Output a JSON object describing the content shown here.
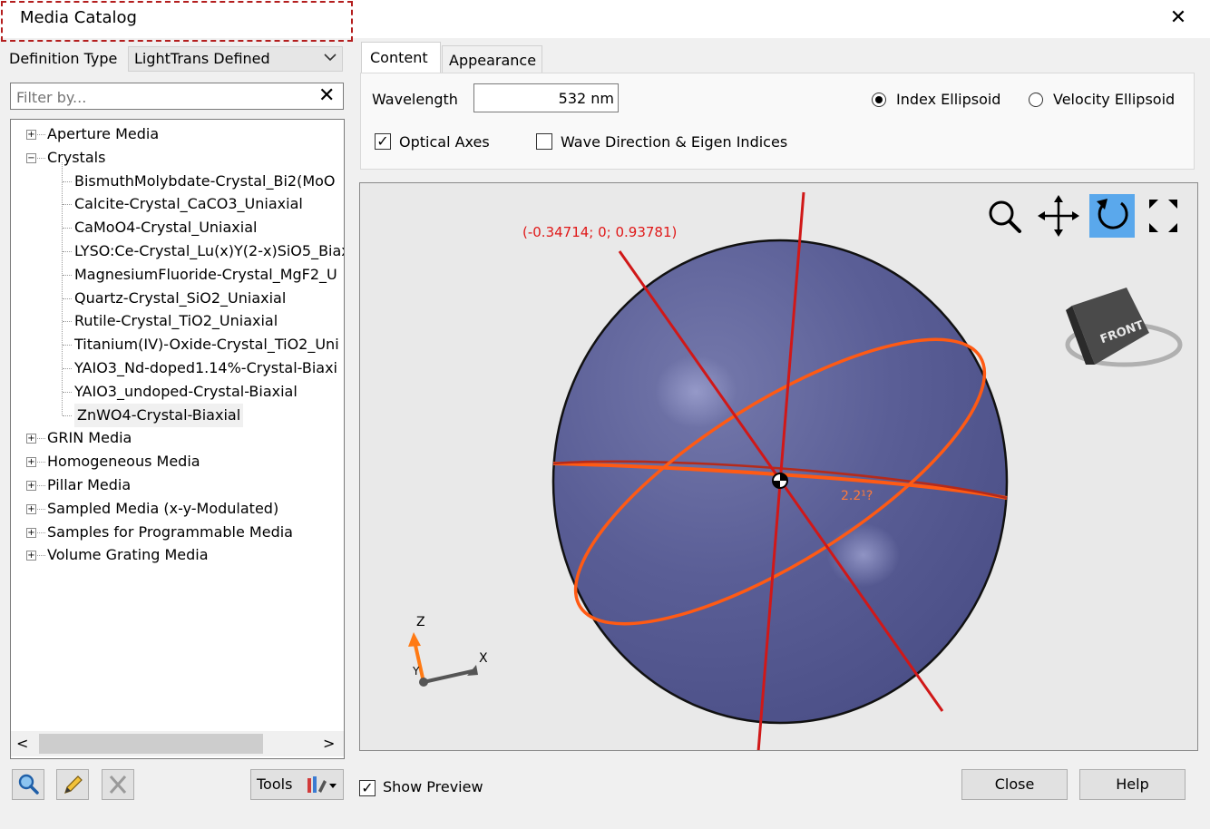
{
  "window": {
    "title": "Media Catalog",
    "close_glyph": "✕"
  },
  "definition": {
    "label": "Definition Type",
    "value": "LightTrans Defined"
  },
  "filter": {
    "placeholder": "Filter by...",
    "clear_glyph": "✕"
  },
  "tree": {
    "items": [
      {
        "label": "Aperture Media",
        "expanded": false
      },
      {
        "label": "Crystals",
        "expanded": true
      },
      {
        "label": "BismuthMolybdate-Crystal_Bi2(MoO"
      },
      {
        "label": "Calcite-Crystal_CaCO3_Uniaxial"
      },
      {
        "label": "CaMoO4-Crystal_Uniaxial"
      },
      {
        "label": "LYSO:Ce-Crystal_Lu(x)Y(2-x)SiO5_Biax"
      },
      {
        "label": "MagnesiumFluoride-Crystal_MgF2_U"
      },
      {
        "label": "Quartz-Crystal_SiO2_Uniaxial"
      },
      {
        "label": "Rutile-Crystal_TiO2_Uniaxial"
      },
      {
        "label": "Titanium(IV)-Oxide-Crystal_TiO2_Uni"
      },
      {
        "label": "YAIO3_Nd-doped1.14%-Crystal-Biaxi"
      },
      {
        "label": "YAIO3_undoped-Crystal-Biaxial"
      },
      {
        "label": "ZnWO4-Crystal-Biaxial",
        "selected": true
      },
      {
        "label": "GRIN Media",
        "expanded": false
      },
      {
        "label": "Homogeneous Media",
        "expanded": false
      },
      {
        "label": "Pillar Media",
        "expanded": false
      },
      {
        "label": "Sampled Media (x-y-Modulated)",
        "expanded": false
      },
      {
        "label": "Samples for Programmable Media",
        "expanded": false
      },
      {
        "label": "Volume Grating Media",
        "expanded": false
      }
    ],
    "scroll_left_glyph": "<",
    "scroll_right_glyph": ">"
  },
  "bottom_left": {
    "tools_label": "Tools",
    "icons": [
      "search-icon",
      "edit-pencil-icon",
      "delete-x-icon",
      "tools-wrench-icon"
    ]
  },
  "tabs": [
    {
      "label": "Content",
      "active": true
    },
    {
      "label": "Appearance",
      "active": false
    }
  ],
  "content": {
    "wavelength_label": "Wavelength",
    "wavelength_value": "532 nm",
    "radio_index": "Index Ellipsoid",
    "radio_velocity": "Velocity Ellipsoid",
    "selected_radio": "Index Ellipsoid",
    "check_optical_axes": "Optical Axes",
    "optical_axes_checked": true,
    "check_wave_direction": "Wave Direction & Eigen Indices",
    "wave_direction_checked": false
  },
  "viewport": {
    "coordinate_label": "(-0.34714; 0; 0.93781)",
    "partial_label": "2.2¹?",
    "cube_face_label": "FRONT",
    "axis_z": "Z",
    "axis_x": "X",
    "axis_y": "Y",
    "toolbar_icons": [
      "zoom-icon",
      "pan-icon",
      "rotate-icon",
      "fit-expand-icon"
    ],
    "active_tool": "rotate-icon",
    "colors": {
      "sphere": "#53578f",
      "axes_red": "#d01818",
      "ellipse_orange": "#ff5a14",
      "tool_active": "#5aa8ec"
    }
  },
  "footer": {
    "show_preview_label": "Show Preview",
    "show_preview_checked": true,
    "close_label": "Close",
    "help_label": "Help"
  }
}
